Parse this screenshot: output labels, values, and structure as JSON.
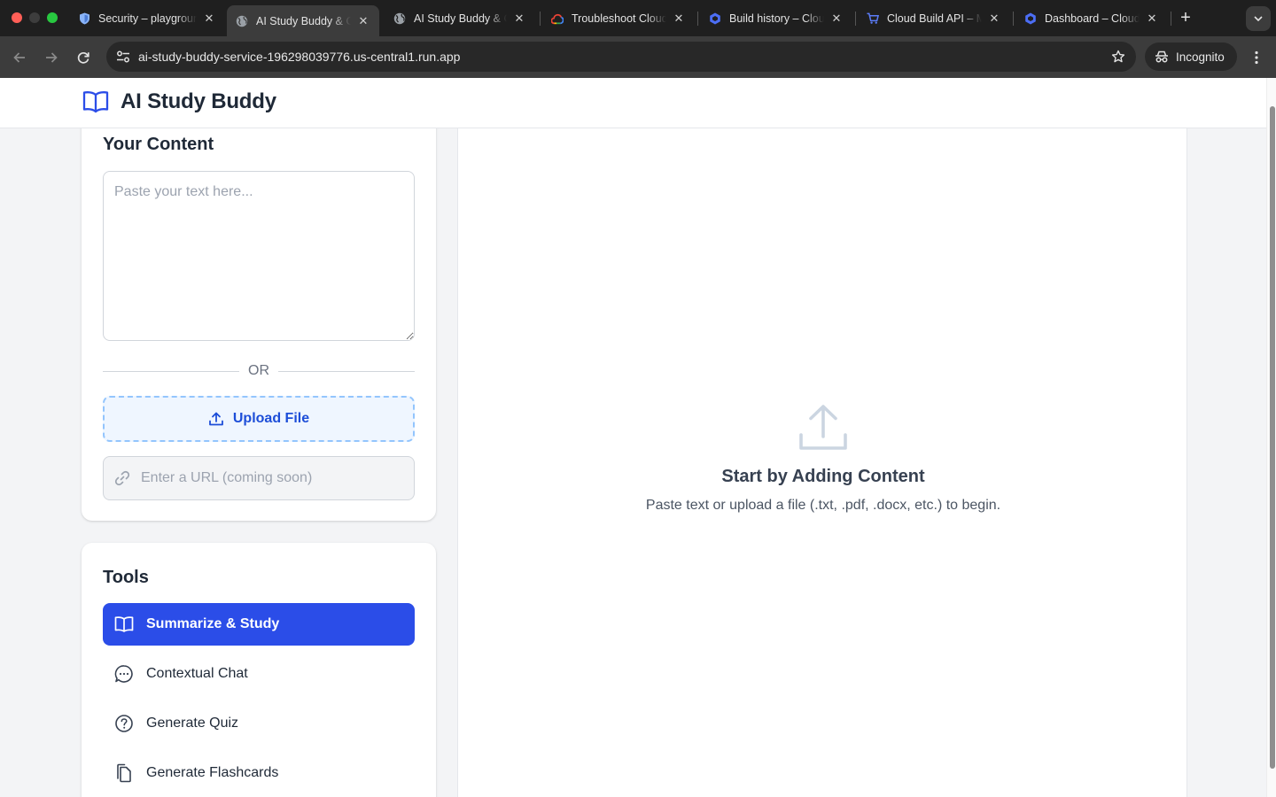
{
  "browser": {
    "tabs": [
      {
        "title": "Security – playground",
        "icon": "shield-favicon",
        "active": false
      },
      {
        "title": "AI Study Buddy & Content",
        "icon": "globe-favicon",
        "active": true
      },
      {
        "title": "AI Study Buddy & Content",
        "icon": "globe-favicon",
        "active": false
      },
      {
        "title": "Troubleshoot Cloud Run",
        "icon": "google-cloud-favicon",
        "active": false
      },
      {
        "title": "Build history – Cloud Build",
        "icon": "cloud-build-favicon",
        "active": false
      },
      {
        "title": "Cloud Build API – Marketplace",
        "icon": "marketplace-favicon",
        "active": false
      },
      {
        "title": "Dashboard – Cloud Build",
        "icon": "cloud-build-favicon",
        "active": false
      }
    ],
    "address": "ai-study-buddy-service-196298039776.us-central1.run.app",
    "incognito_label": "Incognito"
  },
  "app": {
    "title": "AI Study Buddy",
    "content_section": {
      "title": "Your Content",
      "textarea_placeholder": "Paste your text here...",
      "or_label": "OR",
      "upload_label": "Upload File",
      "url_placeholder": "Enter a URL (coming soon)"
    },
    "tools_section": {
      "title": "Tools",
      "items": [
        {
          "label": "Summarize & Study",
          "icon": "book-open-icon",
          "active": true
        },
        {
          "label": "Contextual Chat",
          "icon": "chat-bubble-icon",
          "active": false
        },
        {
          "label": "Generate Quiz",
          "icon": "question-circle-icon",
          "active": false
        },
        {
          "label": "Generate Flashcards",
          "icon": "cards-icon",
          "active": false
        }
      ]
    },
    "empty_state": {
      "title": "Start by Adding Content",
      "message": "Paste text or upload a file (.txt, .pdf, .docx, etc.) to begin."
    }
  },
  "colors": {
    "accent": "#2b4de8",
    "upload_text": "#1d4ed8",
    "upload_bg": "#eff6ff",
    "upload_border": "#93c5fd",
    "page_bg": "#f3f4f6"
  }
}
